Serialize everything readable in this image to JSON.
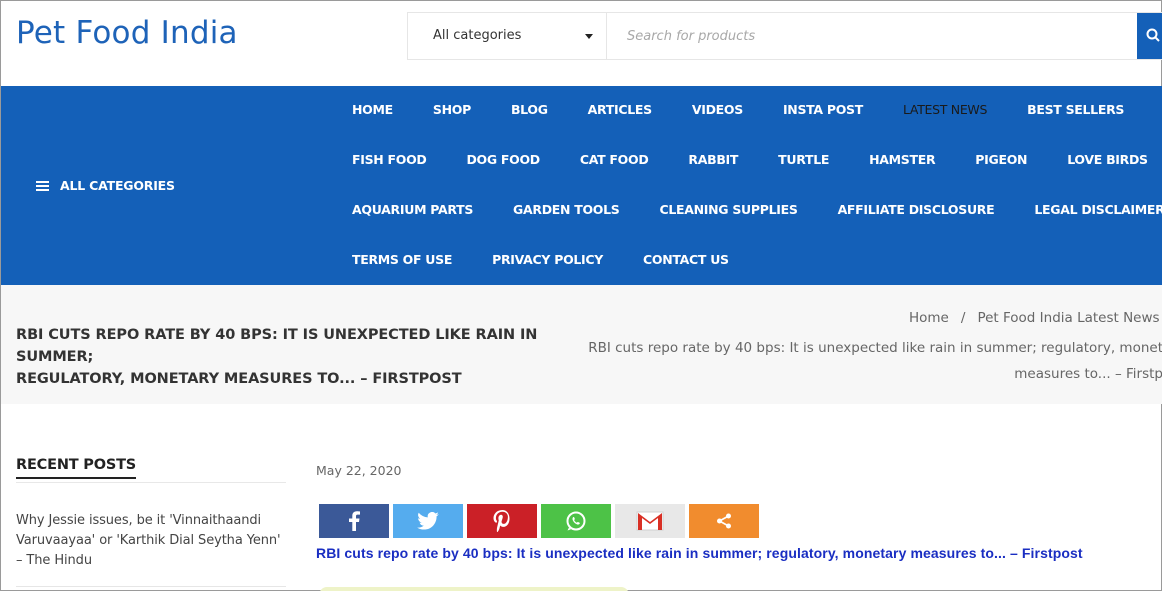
{
  "site": {
    "name": "Pet Food India"
  },
  "search": {
    "category": "All categories",
    "placeholder": "Search for products"
  },
  "nav": {
    "all_categories": "ALL CATEGORIES",
    "rows": [
      [
        "HOME",
        "SHOP",
        "BLOG",
        "ARTICLES",
        "VIDEOS",
        "INSTA POST",
        "LATEST NEWS",
        "BEST SELLERS"
      ],
      [
        "FISH FOOD",
        "DOG FOOD",
        "CAT FOOD",
        "RABBIT",
        "TURTLE",
        "HAMSTER",
        "PIGEON",
        "LOVE BIRDS"
      ],
      [
        "AQUARIUM PARTS",
        "GARDEN TOOLS",
        "CLEANING SUPPLIES",
        "AFFILIATE DISCLOSURE",
        "LEGAL DISCLAIMER"
      ],
      [
        "TERMS OF USE",
        "PRIVACY POLICY",
        "CONTACT US"
      ]
    ],
    "active": "LATEST NEWS"
  },
  "page": {
    "title_line1": "RBI CUTS REPO RATE BY 40 BPS: IT IS UNEXPECTED LIKE RAIN IN SUMMER;",
    "title_line2": "REGULATORY, MONETARY MEASURES TO... – FIRSTPOST",
    "breadcrumb": {
      "home": "Home",
      "separator": "/",
      "section": "Pet Food India Latest News",
      "current_line1": "RBI cuts repo rate by 40 bps: It is unexpected like rain in summer; regulatory, monet",
      "current_line2": "measures to... – Firstp"
    }
  },
  "sidebar": {
    "recent_posts_heading": "RECENT POSTS",
    "posts": [
      "Why Jessie issues, be it 'Vinnaithaandi Varuvaayaa' or 'Karthik Dial Seytha Yenn' – The Hindu"
    ]
  },
  "post": {
    "date": "May 22, 2020",
    "link_text": "RBI cuts repo rate by 40 bps: It is unexpected like rain in summer; regulatory, monetary measures to... – Firstpost",
    "share_buttons": [
      "facebook-icon",
      "twitter-icon",
      "pinterest-icon",
      "whatsapp-icon",
      "gmail-icon",
      "share-icon"
    ]
  },
  "colors": {
    "brand_blue": "#1460b8",
    "logo_blue": "#1e63b8",
    "link_blue": "#1a2ec2"
  }
}
